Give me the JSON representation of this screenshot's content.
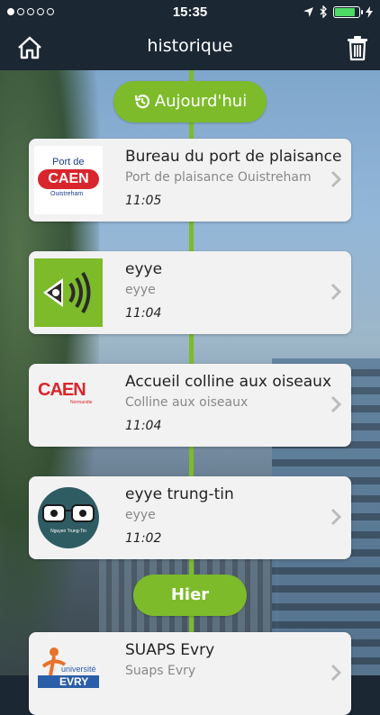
{
  "status_bar": {
    "signal_dots": [
      true,
      false,
      false,
      false,
      false
    ],
    "time": "15:35",
    "battery_color": "#4cd964"
  },
  "header": {
    "title": "historique",
    "left_icon": "home-icon",
    "right_icon": "trash-icon"
  },
  "colors": {
    "accent": "#7dbb2a",
    "header_bg": "#1b2733",
    "card_bg": "#f2f2f2"
  },
  "timeline": {
    "today_label": "Aujourd'hui",
    "today_icon": "history-icon",
    "yesterday_label": "Hier"
  },
  "entries": [
    {
      "title": "Bureau du port de plaisance",
      "subtitle": "Port de plaisance Ouistreham",
      "time": "11:05",
      "logo_text": [
        "Port de",
        "CAEN",
        "Ouistreham"
      ]
    },
    {
      "title": "eyye",
      "subtitle": "eyye",
      "time": "11:04",
      "logo_text": []
    },
    {
      "title": "Accueil colline aux oiseaux",
      "subtitle": "Colline aux oiseaux",
      "time": "11:04",
      "logo_text": [
        "CAEN",
        "Normandie"
      ]
    },
    {
      "title": "eyye trung-tin",
      "subtitle": "eyye",
      "time": "11:02",
      "logo_text": [
        "Nguyen Trung-Tin"
      ]
    },
    {
      "title": "SUAPS Evry",
      "subtitle": "Suaps Evry",
      "time": "",
      "logo_text": [
        "université",
        "EVRY"
      ]
    }
  ]
}
